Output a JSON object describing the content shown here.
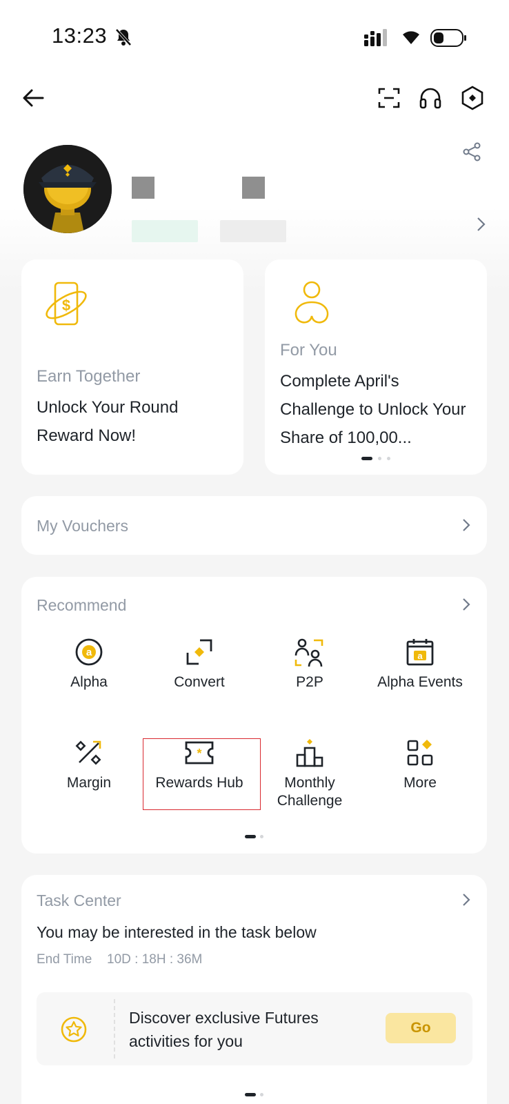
{
  "status_bar": {
    "time": "13:23"
  },
  "profile": {
    "share": "share-icon"
  },
  "cards": {
    "earn": {
      "title": "Earn Together",
      "text": "Unlock Your Round Reward Now!"
    },
    "for_you": {
      "title": "For You",
      "text": "Complete April's Challenge to Unlock Your Share of 100,00..."
    }
  },
  "vouchers": {
    "label": "My Vouchers"
  },
  "recommend": {
    "label": "Recommend",
    "items": [
      {
        "label": "Alpha",
        "icon": "alpha-icon"
      },
      {
        "label": "Convert",
        "icon": "convert-icon"
      },
      {
        "label": "P2P",
        "icon": "p2p-icon"
      },
      {
        "label": "Alpha Events",
        "icon": "alpha-events-icon"
      },
      {
        "label": "Margin",
        "icon": "margin-icon"
      },
      {
        "label": "Rewards Hub",
        "icon": "rewards-hub-icon"
      },
      {
        "label": "Monthly Challenge",
        "icon": "monthly-challenge-icon"
      },
      {
        "label": "More",
        "icon": "more-icon"
      }
    ]
  },
  "task_center": {
    "label": "Task Center",
    "subtitle": "You may be interested in the task below",
    "end_label": "End Time",
    "end_value": "10D : 18H : 36M",
    "task_text": "Discover exclusive Futures activities for you",
    "go_label": "Go"
  },
  "colors": {
    "accent": "#f0b90b",
    "text": "#1e2329",
    "muted": "#929aa5",
    "highlight": "#d9272e"
  }
}
